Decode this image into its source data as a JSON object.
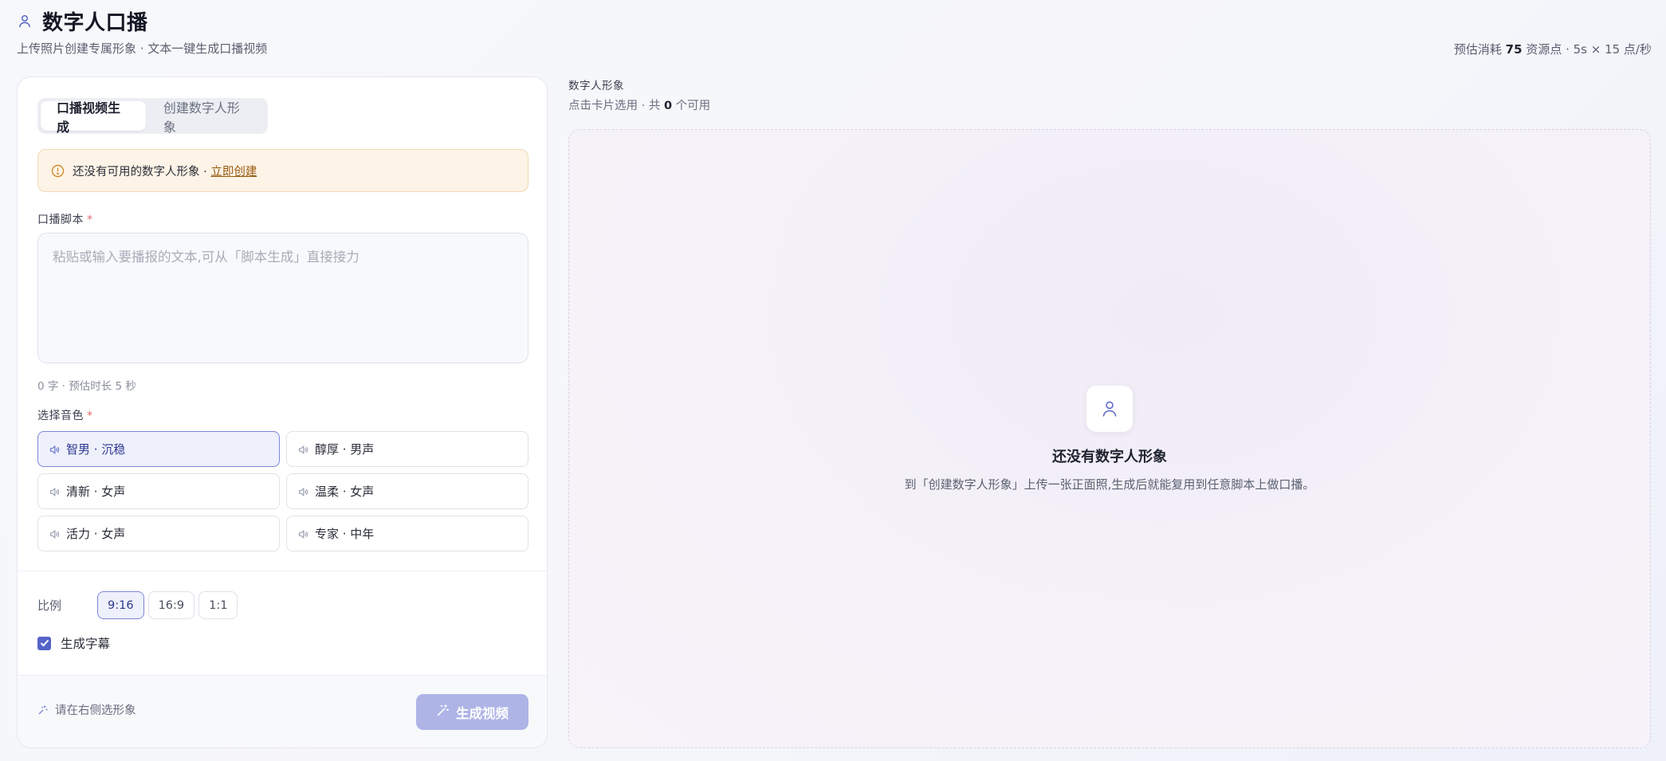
{
  "header": {
    "title": "数字人口播",
    "subtitle": "上传照片创建专属形象 · 文本一键生成口播视频",
    "cost_prefix": "预估消耗",
    "cost_value": "75",
    "cost_suffix": "资源点 · 5s × 15 点/秒"
  },
  "tabs": [
    {
      "label": "口播视频生成",
      "active": true
    },
    {
      "label": "创建数字人形象",
      "active": false
    }
  ],
  "alert": {
    "text": "还没有可用的数字人形象 · ",
    "link": "立即创建"
  },
  "script": {
    "label": "口播脚本",
    "required_mark": "*",
    "placeholder": "粘贴或输入要播报的文本,可从「脚本生成」直接接力",
    "value": "",
    "count_text": "0 字 · 预估时长 5 秒"
  },
  "voice": {
    "label": "选择音色",
    "required_mark": "*",
    "options": [
      {
        "label": "智男 · 沉稳",
        "selected": true
      },
      {
        "label": "醇厚 · 男声",
        "selected": false
      },
      {
        "label": "清新 · 女声",
        "selected": false
      },
      {
        "label": "温柔 · 女声",
        "selected": false
      },
      {
        "label": "活力 · 女声",
        "selected": false
      },
      {
        "label": "专家 · 中年",
        "selected": false
      }
    ]
  },
  "ratio": {
    "label": "比例",
    "options": [
      {
        "label": "9:16",
        "active": true
      },
      {
        "label": "16:9",
        "active": false
      },
      {
        "label": "1:1",
        "active": false
      }
    ]
  },
  "subtitle_option": {
    "label": "生成字幕",
    "checked": true
  },
  "footer": {
    "hint": "请在右侧选形象",
    "generate_label": "生成视频"
  },
  "avatar_panel": {
    "title": "数字人形象",
    "sub_prefix": "点击卡片选用 · 共",
    "count": "0",
    "sub_suffix": "个可用",
    "empty_title": "还没有数字人形象",
    "empty_desc": "到「创建数字人形象」上传一张正面照,生成后就能复用到任意脚本上做口播。"
  },
  "colors": {
    "accent": "#5563c8",
    "accent_light": "#eef0fc",
    "warning_bg": "#fdf3e6",
    "button_disabled": "#aeb4e6"
  },
  "icons": {
    "title": "user-icon",
    "alert": "alert-circle-icon",
    "voice": "speaker-icon",
    "hint": "sparkle-icon",
    "generate": "magic-wand-icon",
    "empty": "user-icon"
  }
}
